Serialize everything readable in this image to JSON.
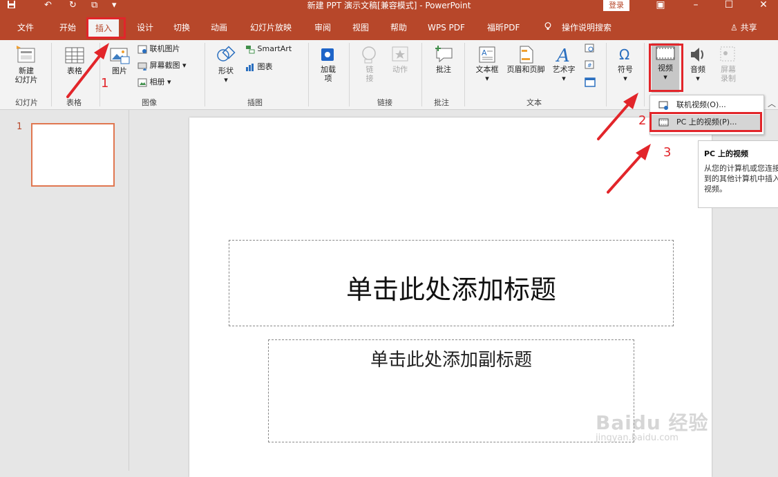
{
  "window": {
    "title": "新建 PPT 演示文稿[兼容模式] - PowerPoint",
    "login": "登录"
  },
  "tabs": [
    "文件",
    "开始",
    "插入",
    "设计",
    "切换",
    "动画",
    "幻灯片放映",
    "审阅",
    "视图",
    "帮助",
    "WPS PDF",
    "福昕PDF"
  ],
  "search_hint": "操作说明搜索",
  "share": "共享",
  "ribbon": {
    "new_slide": "新建\n幻灯片",
    "table": "表格",
    "picture": "图片",
    "online_picture": "联机图片",
    "screenshot": "屏幕截图",
    "album": "相册",
    "shapes": "形状",
    "smartart": "SmartArt",
    "chart": "图表",
    "addins": "加载\n项",
    "link": "链\n接",
    "action": "动作",
    "comment": "批注",
    "textbox": "文本框",
    "header_footer": "页眉和页脚",
    "wordart": "艺术字",
    "symbol": "符号",
    "video": "视频",
    "audio": "音频",
    "screen_record": "屏幕\n录制",
    "groups": {
      "slides": "幻灯片",
      "tables": "表格",
      "images": "图像",
      "illustrations": "插图",
      "links": "链接",
      "comments": "批注",
      "text": "文本"
    }
  },
  "video_menu": {
    "online": "联机视频(O)...",
    "pc": "PC 上的视频(P)..."
  },
  "tooltip": {
    "title": "PC 上的视频",
    "desc": "从您的计算机或您连接到的其他计算机中插入视频。"
  },
  "slide": {
    "number": "1",
    "title_placeholder": "单击此处添加标题",
    "subtitle_placeholder": "单击此处添加副标题"
  },
  "annotations": [
    "1",
    "2",
    "3"
  ],
  "watermark": {
    "brand": "Baidu 经验",
    "url": "jingyan.baidu.com"
  },
  "colors": {
    "accent": "#b7472a",
    "annotation": "#e2252a"
  }
}
